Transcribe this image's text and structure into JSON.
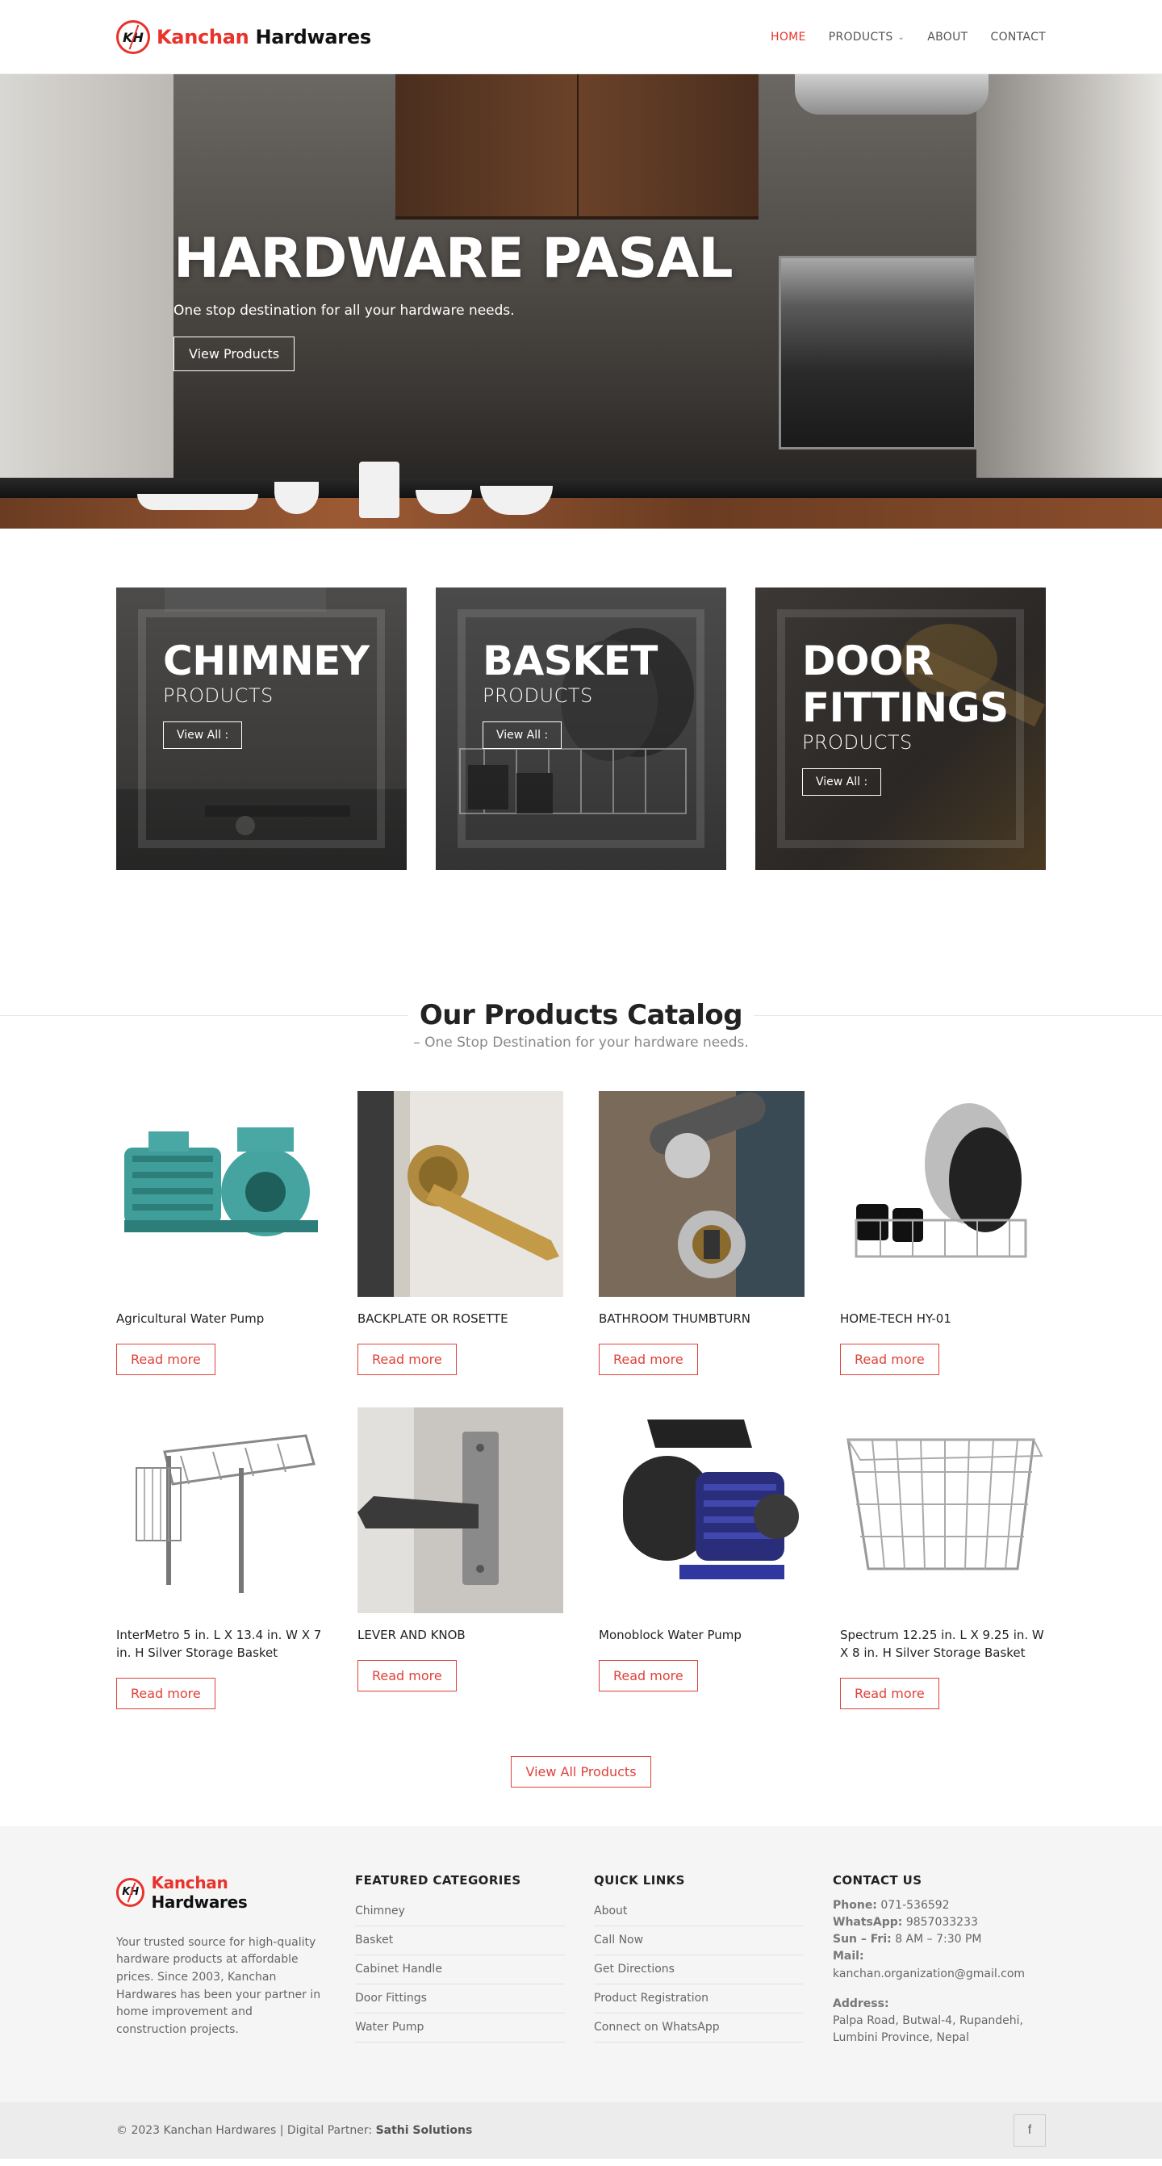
{
  "header": {
    "logo": {
      "mark": "KH",
      "word1": "Kanchan",
      "word2": "Hardwares"
    },
    "nav": [
      {
        "label": "HOME",
        "active": true
      },
      {
        "label": "PRODUCTS",
        "has_dropdown": true
      },
      {
        "label": "ABOUT"
      },
      {
        "label": "CONTACT"
      }
    ]
  },
  "hero": {
    "title": "HARDWARE PASAL",
    "subtitle": "One stop destination for all your hardware needs.",
    "button": "View Products"
  },
  "categories": [
    {
      "title": "CHIMNEY",
      "sub": "PRODUCTS",
      "button": "View All :"
    },
    {
      "title": "BASKET",
      "sub": "PRODUCTS",
      "button": "View All :"
    },
    {
      "title": "DOOR FITTINGS",
      "title_line1": "DOOR",
      "title_line2": "FITTINGS",
      "sub": "PRODUCTS",
      "button": "View All :"
    }
  ],
  "catalog": {
    "title": "Our Products Catalog",
    "subtitle": "– One Stop Destination for your hardware needs.",
    "read_more": "Read more",
    "products": [
      {
        "name": "Agricultural Water Pump",
        "image": "water-pump"
      },
      {
        "name": "BACKPLATE OR ROSETTE",
        "image": "door-handle-gold"
      },
      {
        "name": "BATHROOM THUMBTURN",
        "image": "thumbturn-lock"
      },
      {
        "name": "HOME-TECH HY-01",
        "image": "dish-rack"
      },
      {
        "name": "InterMetro 5 in. L X 13.4 in. W X 7 in. H Silver Storage Basket",
        "image": "wire-shelf-basket"
      },
      {
        "name": "LEVER AND KNOB",
        "image": "lever-handle"
      },
      {
        "name": "Monoblock Water Pump",
        "image": "monoblock-pump"
      },
      {
        "name": "Spectrum 12.25 in. L X 9.25 in. W X 8 in. H Silver Storage Basket",
        "image": "wire-basket"
      }
    ],
    "view_all": "View All Products"
  },
  "footer": {
    "logo": {
      "mark": "KH",
      "word1": "Kanchan",
      "word2": "Hardwares"
    },
    "about": "Your trusted source for high-quality hardware products at affordable prices. Since 2003, Kanchan Hardwares has been your partner in home improvement and construction projects.",
    "featured": {
      "heading": "FEATURED CATEGORIES",
      "items": [
        "Chimney",
        "Basket",
        "Cabinet Handle",
        "Door Fittings",
        "Water Pump"
      ]
    },
    "quick": {
      "heading": "QUICK LINKS",
      "items": [
        "About",
        "Call Now",
        "Get Directions",
        "Product Registration",
        "Connect on WhatsApp"
      ]
    },
    "contact": {
      "heading": "CONTACT US",
      "phone_label": "Phone:",
      "phone": "071-536592",
      "whatsapp_label": "WhatsApp:",
      "whatsapp": "9857033233",
      "hours_label": "Sun – Fri:",
      "hours": "8 AM – 7:30 PM",
      "mail_label": "Mail:",
      "mail": "kanchan.organization@gmail.com",
      "address_label": "Address:",
      "address": "Palpa Road, Butwal-4, Rupandehi, Lumbini Province, Nepal"
    },
    "copyright_prefix": "© 2023 Kanchan Hardwares | Digital Partner:",
    "partner": "Sathi Solutions",
    "social_icon": "facebook-icon",
    "social_glyph": "f"
  },
  "colors": {
    "accent": "#e8322a",
    "button_red": "#e0413a",
    "footer_bg": "#f5f5f5"
  }
}
